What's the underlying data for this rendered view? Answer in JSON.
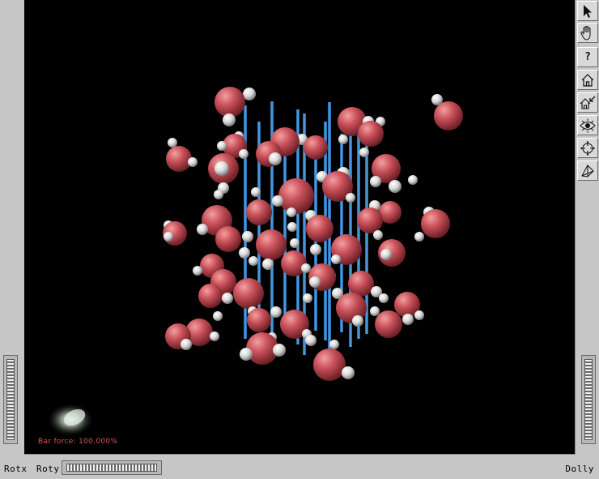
{
  "viewer": {
    "force_label": "Bar force: 100.000%"
  },
  "toolbar": {
    "items": [
      {
        "name": "select-tool",
        "icon": "arrow-pointer-icon"
      },
      {
        "name": "pan-tool",
        "icon": "hand-icon"
      },
      {
        "name": "help",
        "icon": "question-icon",
        "label": "?"
      },
      {
        "name": "home",
        "icon": "home-icon"
      },
      {
        "name": "set-home",
        "icon": "set-home-icon"
      },
      {
        "name": "view-all",
        "icon": "eye-icon"
      },
      {
        "name": "seek",
        "icon": "crosshair-icon"
      },
      {
        "name": "projection",
        "icon": "perspective-icon"
      }
    ]
  },
  "bottom_bar": {
    "rotx_label": "Rotx",
    "roty_label": "Roty",
    "dolly_label": "Dolly"
  },
  "colors": {
    "background": "#000000",
    "oxygen": "#c2484e",
    "hydrogen": "#e6e6e6",
    "bar": "#3a8ad0",
    "frame": "#c6c6c6"
  }
}
